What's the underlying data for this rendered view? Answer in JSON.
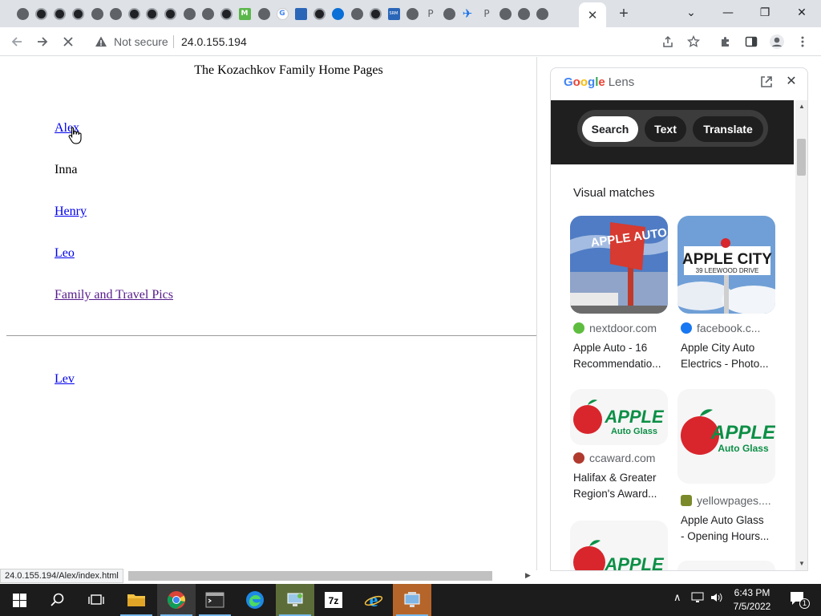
{
  "browser": {
    "tabs_favicons": [
      "chrome-globe",
      "dark-circle",
      "eye-circle",
      "link-circle",
      "globe",
      "globe",
      "dark-circle",
      "dark-circle",
      "dark-circle",
      "globe",
      "globe",
      "dark-circle",
      "m-green",
      "globe",
      "g-logo",
      "blue-square",
      "dark-circle",
      "edge",
      "globe",
      "dark-circle",
      "srm",
      "globe",
      "p",
      "globe",
      "plane",
      "p",
      "globe",
      "globe",
      "globe"
    ],
    "tab_letters": {
      "m": "M",
      "g": "G",
      "srm": "SRM",
      "p": "P"
    },
    "active_tab_close": "✕",
    "new_tab": "+",
    "window_controls": {
      "dropdown": "⌄",
      "minimize": "—",
      "restore": "❐",
      "close": "✕"
    },
    "omnibox": {
      "security_label": "Not secure",
      "url": "24.0.155.194"
    }
  },
  "page": {
    "title": "The Kozachkov Family Home Pages",
    "links": {
      "alex": "Alex",
      "inna": "Inna",
      "henry": "Henry",
      "leo": "Leo",
      "family_pics": "Family and Travel Pics",
      "lev": "Lev"
    },
    "status_url": "24.0.155.194/Alex/index.html"
  },
  "lens": {
    "title_google": "Google",
    "title_lens": "Lens",
    "tabs": [
      "Search",
      "Text",
      "Translate"
    ],
    "section_heading": "Visual matches",
    "results": [
      {
        "source": "nextdoor.com",
        "title_line1": "Apple Auto - 16",
        "title_line2": "Recommendatio...",
        "image_text": "APPLE AUTO"
      },
      {
        "source": "facebook.c...",
        "title_line1": "Apple City Auto",
        "title_line2": "Electrics - Photo...",
        "image_text": "APPLE CITY",
        "image_sub": "39 LEEWOOD DRIVE"
      },
      {
        "source": "ccaward.com",
        "title_line1": "Halifax & Greater",
        "title_line2": "Region's Award...",
        "image_text": "APPLE",
        "image_sub": "Auto Glass"
      },
      {
        "source": "yellowpages....",
        "title_line1": "Apple Auto Glass",
        "title_line2": "- Opening Hours...",
        "image_text": "APPLE",
        "image_sub": "Auto Glass"
      },
      {
        "image_text": "APPLE"
      }
    ],
    "colors": {
      "bar": "#1f1f1f",
      "apple_green": "#0c8f46",
      "apple_red": "#d8262c"
    }
  },
  "taskbar": {
    "clock_time": "6:43 PM",
    "clock_date": "7/5/2022",
    "notification_count": "1",
    "apps": [
      "start",
      "search",
      "task-view",
      "file-explorer",
      "chrome",
      "terminal",
      "edge",
      "network-app",
      "7zip",
      "internet-explorer",
      "remote-app"
    ]
  }
}
